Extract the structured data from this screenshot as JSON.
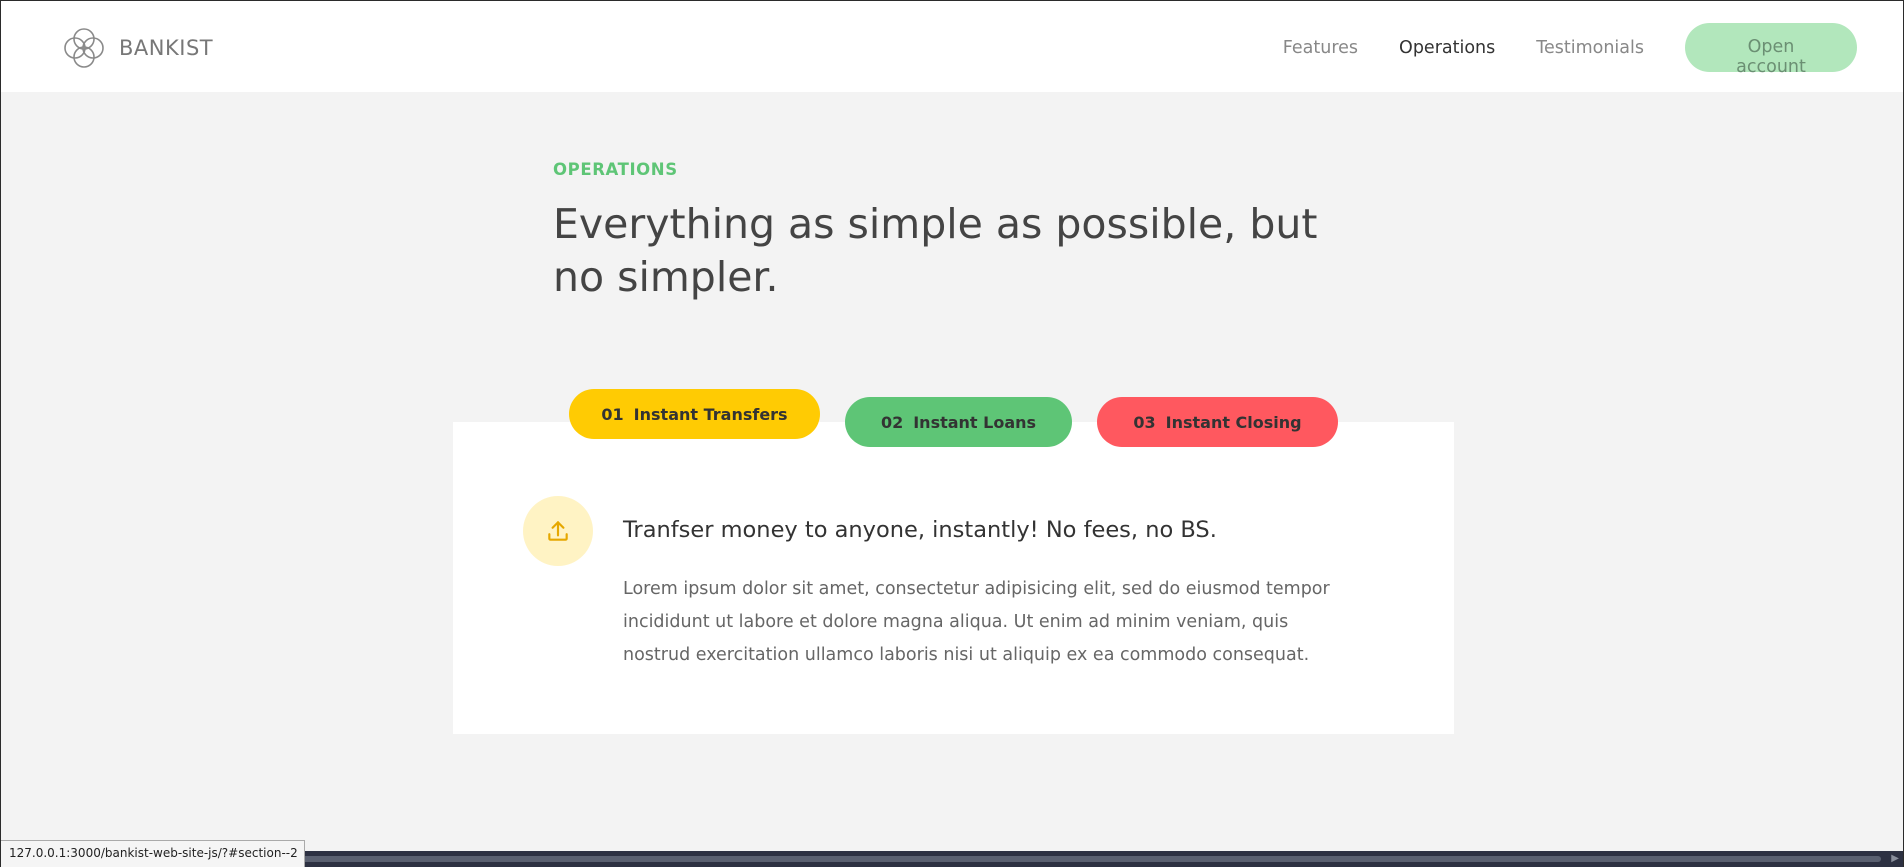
{
  "nav": {
    "logo_text": "BANKIST",
    "links": [
      "Features",
      "Operations",
      "Testimonials"
    ],
    "cta_label": "Open account"
  },
  "section": {
    "label": "OPERATIONS",
    "title": "Everything as simple as possible, but no simpler."
  },
  "tabs": [
    {
      "num": "01",
      "label": "Instant Transfers",
      "color": "#ffcb03"
    },
    {
      "num": "02",
      "label": "Instant Loans",
      "color": "#5ec576"
    },
    {
      "num": "03",
      "label": "Instant Closing",
      "color": "#ff585f"
    }
  ],
  "content": {
    "icon": "upload-icon",
    "heading": "Tranfser money to anyone, instantly! No fees, no BS.",
    "text": "Lorem ipsum dolor sit amet, consectetur adipisicing elit, sed do eiusmod tempor incididunt ut labore et dolore magna aliqua. Ut enim ad minim veniam, quis nostrud exercitation ullamco laboris nisi ut aliquip ex ea commodo consequat."
  },
  "status_bar": {
    "url": "127.0.0.1:3000/bankist-web-site-js/?#section--2"
  },
  "colors": {
    "accent_green": "#5ec576",
    "accent_yellow": "#ffcb03",
    "accent_red": "#ff585f"
  }
}
